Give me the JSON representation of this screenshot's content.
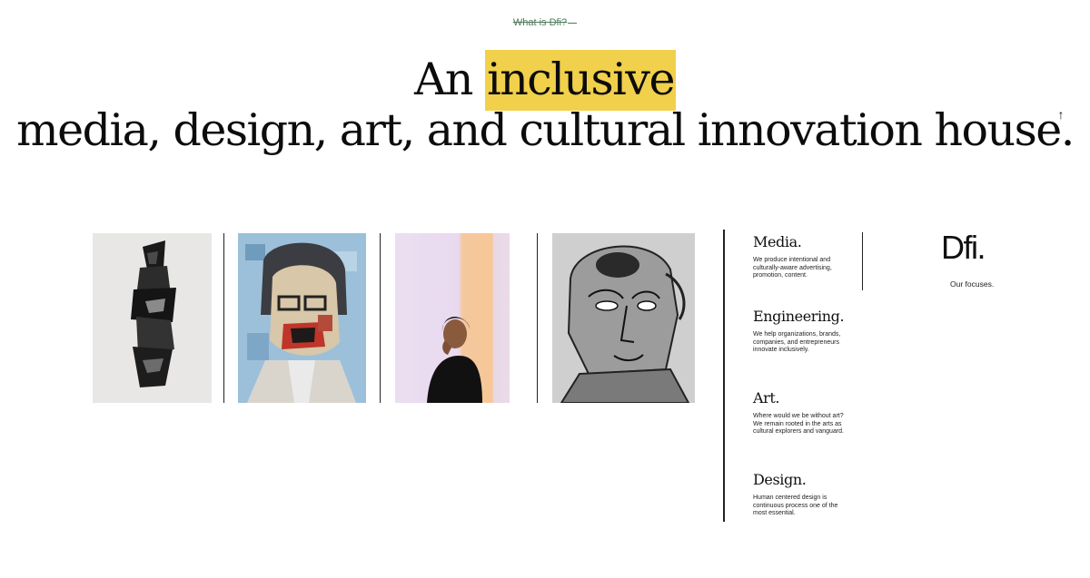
{
  "header": {
    "eyebrow_link": "What is Dfi?",
    "headline": {
      "lead": "An ",
      "highlight": "inclusive",
      "rest": " media, design, art, and cultural innovation house."
    }
  },
  "nav": {
    "scroll_top_glyph": "↑"
  },
  "gallery": {
    "items": [
      {
        "kind": "collage-portrait"
      },
      {
        "kind": "mosaic-portrait"
      },
      {
        "kind": "photo-portrait"
      },
      {
        "kind": "sketch-portrait"
      }
    ]
  },
  "focuses": [
    {
      "title": "Media.",
      "text": "We produce intentional and culturally-aware advertising, promotion, content."
    },
    {
      "title": "Engineering.",
      "text": "We help organizations, brands, companies, and entrepreneurs innovate inclusively."
    },
    {
      "title": "Art.",
      "text": "Where would we be without art? We remain rooted in the arts as cultural explorers and vanguard."
    },
    {
      "title": "Design.",
      "text": "Human centered design is continuous process one of the most essential."
    }
  ],
  "brand": {
    "logo": "Dfi.",
    "caption": "Our focuses."
  },
  "colors": {
    "highlight": "#f1d04b",
    "link_green": "#4f7a5c"
  }
}
